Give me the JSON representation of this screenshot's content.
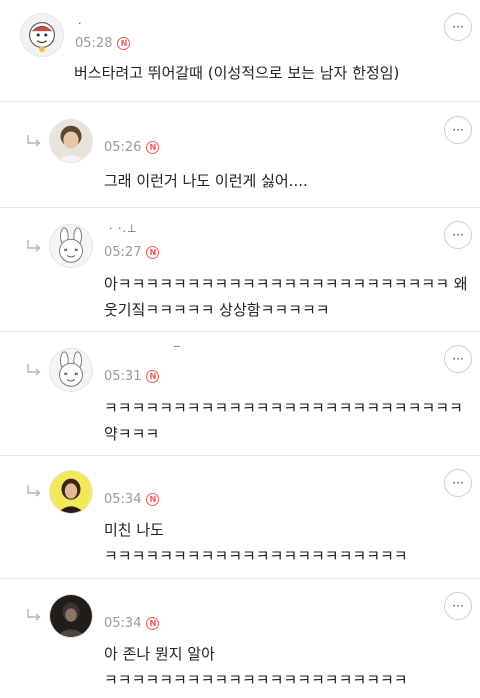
{
  "comments": [
    {
      "nickname": "·",
      "time": "05:28",
      "badge": "N",
      "lines": [
        "버스타려고 뛰어갈때 (이성적으로 보는 남자 한정임)"
      ],
      "more": "···"
    },
    {
      "nickname": "",
      "time": "05:26",
      "badge": "N",
      "lines": [
        "그래 이런거 나도 이런게 싫어...."
      ],
      "more": "···"
    },
    {
      "nickname": "·  ·.⊥",
      "time": "05:27",
      "badge": "N",
      "lines": [
        "아ㅋㅋㅋㅋㅋㅋㅋㅋㅋㅋㅋㅋㅋㅋㅋㅋㅋㅋㅋㅋㅋㅋㅋㅋ 왜",
        "웃기짘ㅋㅋㅋㅋㅋ 상상함ㅋㅋㅋㅋㅋ"
      ],
      "more": "···"
    },
    {
      "nickname": "‾",
      "time": "05:31",
      "badge": "N",
      "lines": [
        "ㅋㅋㅋㅋㅋㅋㅋㅋㅋㅋㅋㅋㅋㅋㅋㅋㅋㅋㅋㅋㅋㅋㅋㅋㅋㅋ",
        "약ㅋㅋㅋ"
      ],
      "more": "···"
    },
    {
      "nickname": "",
      "time": "05:34",
      "badge": "N",
      "lines": [
        "미친 나도",
        "ㅋㅋㅋㅋㅋㅋㅋㅋㅋㅋㅋㅋㅋㅋㅋㅋㅋㅋㅋㅋㅋㅋ"
      ],
      "more": "···"
    },
    {
      "nickname": "",
      "time": "05:34",
      "badge": "N",
      "lines": [
        "아 존나 뭔지 알아",
        "ㅋㅋㅋㅋㅋㅋㅋㅋㅋㅋㅋㅋㅋㅋㅋㅋㅋㅋㅋㅋㅋㅋ"
      ],
      "more": "···"
    }
  ]
}
